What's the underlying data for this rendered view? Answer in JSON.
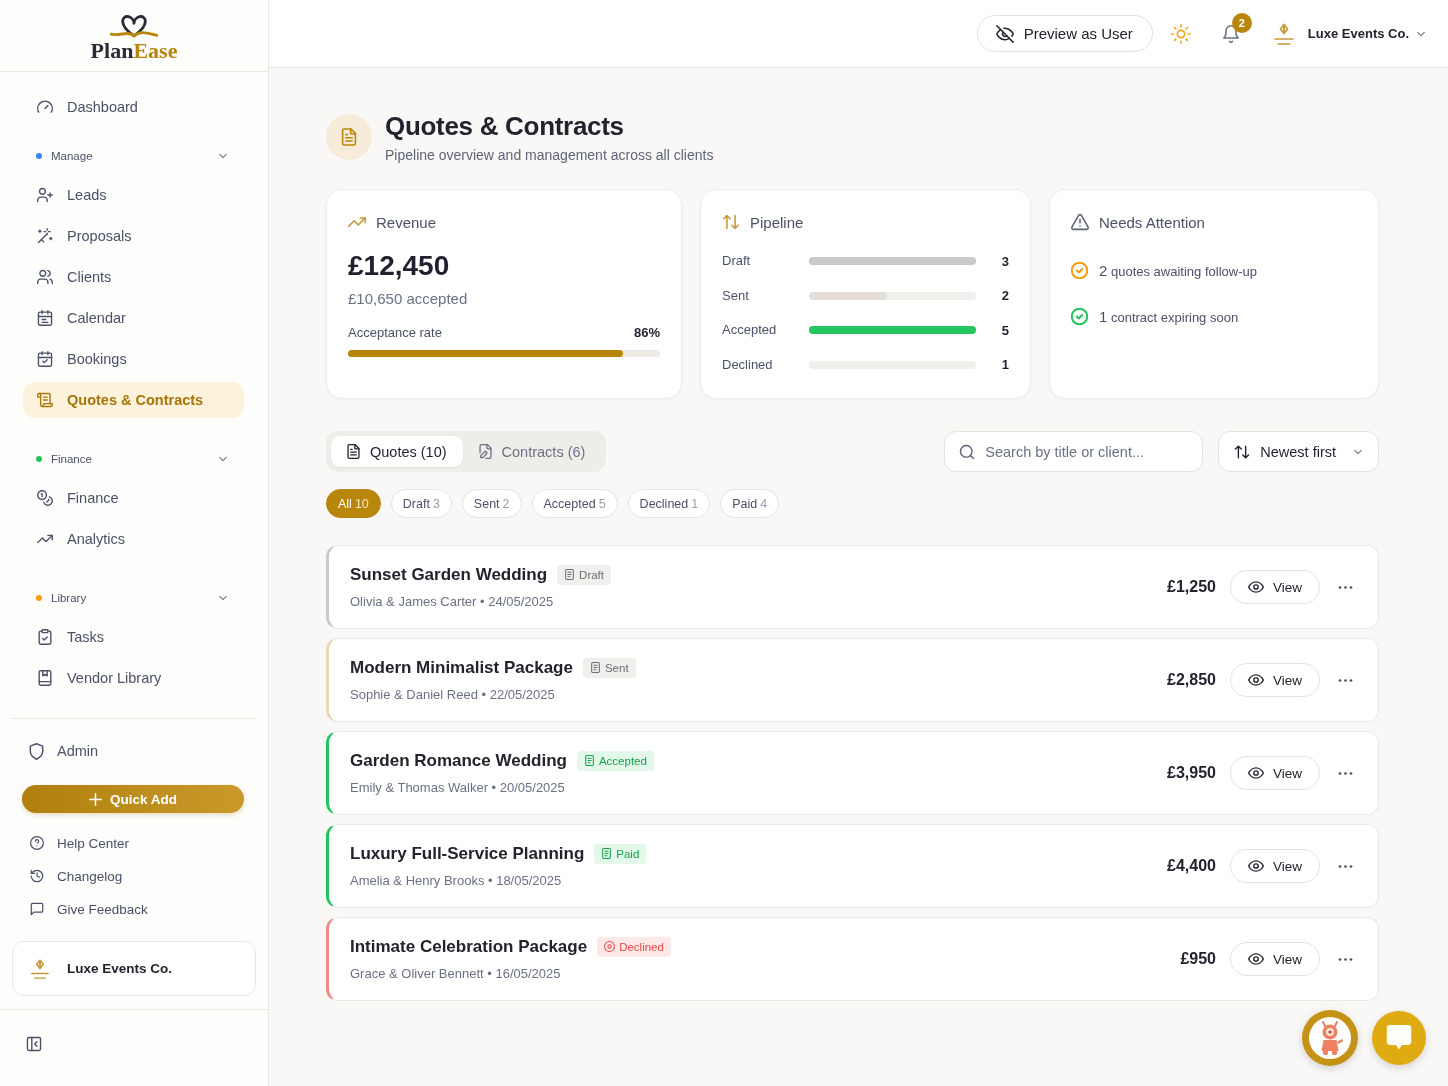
{
  "sidebar": {
    "logo": {
      "name": "Plan",
      "accent": "Ease"
    },
    "nav": [
      {
        "kind": "link",
        "label": "Dashboard",
        "selected": false
      },
      {
        "kind": "group",
        "label": "Manage",
        "color": "#3b82f6",
        "expanded": true,
        "items": [
          {
            "label": "Leads",
            "selected": false
          },
          {
            "label": "Proposals",
            "selected": false
          },
          {
            "label": "Clients",
            "selected": false
          },
          {
            "label": "Calendar",
            "selected": false
          },
          {
            "label": "Bookings",
            "selected": false
          },
          {
            "label": "Quotes & Contracts",
            "selected": true
          }
        ]
      },
      {
        "kind": "group",
        "label": "Finance",
        "color": "#22c55e",
        "expanded": true,
        "items": [
          {
            "label": "Finance",
            "selected": false
          },
          {
            "label": "Analytics",
            "selected": false
          }
        ]
      },
      {
        "kind": "group",
        "label": "Library",
        "color": "#f59e0b",
        "expanded": true,
        "items": [
          {
            "label": "Tasks",
            "selected": false
          },
          {
            "label": "Vendor Library",
            "selected": false
          }
        ]
      }
    ],
    "admin": "Admin",
    "quick_add": "Quick Add",
    "links": [
      "Help Center",
      "Changelog",
      "Give Feedback"
    ],
    "workspace": "Luxe Events Co."
  },
  "topbar": {
    "preview_button": "Preview as User",
    "notification_count": "2",
    "account": "Luxe Events Co."
  },
  "header": {
    "title": "Quotes & Contracts",
    "subtitle": "Pipeline overview and management across all clients"
  },
  "revenue": {
    "title": "Revenue",
    "amount": "£12,450",
    "accepted": "£10,650 accepted",
    "rate_label": "Acceptance rate",
    "rate": "86%",
    "level": 0.88
  },
  "pipeline": {
    "title": "Pipeline",
    "stages": [
      {
        "label": "Draft",
        "count": "3",
        "level": 1.0,
        "color": "#c9c9c9"
      },
      {
        "label": "Sent",
        "count": "2",
        "level": 0.47,
        "color": "#e3ded7"
      },
      {
        "label": "Accepted",
        "count": "5",
        "level": 1.0,
        "color": "#22c55e"
      },
      {
        "label": "Declined",
        "count": "1"
      }
    ]
  },
  "attention": {
    "title": "Needs Attention",
    "items": [
      {
        "count": "2",
        "text": "quotes awaiting follow-up",
        "color": "#f59e0b"
      },
      {
        "count": "1",
        "text": "contract expiring soon",
        "color": "#22c55e"
      }
    ]
  },
  "tabs": [
    {
      "label": "Quotes (10)",
      "selected": true
    },
    {
      "label": "Contracts (6)",
      "selected": false
    }
  ],
  "search": {
    "placeholder": "Search by title or client..."
  },
  "sort": {
    "label": "Newest first"
  },
  "filters": [
    {
      "label": "All",
      "count": "10",
      "selected": true
    },
    {
      "label": "Draft",
      "count": "3",
      "selected": false
    },
    {
      "label": "Sent",
      "count": "2",
      "selected": false
    },
    {
      "label": "Accepted",
      "count": "5",
      "selected": false
    },
    {
      "label": "Declined",
      "count": "1",
      "selected": false
    },
    {
      "label": "Paid",
      "count": "4",
      "selected": false
    }
  ],
  "quotes": [
    {
      "kind": "draft",
      "title": "Sunset Garden Wedding",
      "status": "Draft",
      "meta": "Olivia & James Carter • 24/05/2025",
      "amount": "£1,250",
      "action": "View"
    },
    {
      "kind": "sent",
      "title": "Modern Minimalist Package",
      "status": "Sent",
      "meta": "Sophie & Daniel Reed • 22/05/2025",
      "amount": "£2,850",
      "action": "View"
    },
    {
      "kind": "accepted",
      "title": "Garden Romance Wedding",
      "status": "Accepted",
      "meta": "Emily & Thomas Walker • 20/05/2025",
      "amount": "£3,950",
      "action": "View"
    },
    {
      "kind": "paid",
      "title": "Luxury Full-Service Planning",
      "status": "Paid",
      "meta": "Amelia & Henry Brooks • 18/05/2025",
      "amount": "£4,400",
      "action": "View"
    },
    {
      "kind": "declined",
      "title": "Intimate Celebration Package",
      "status": "Declined",
      "meta": "Grace & Oliver Bennett • 16/05/2025",
      "amount": "£950",
      "action": "View"
    }
  ]
}
